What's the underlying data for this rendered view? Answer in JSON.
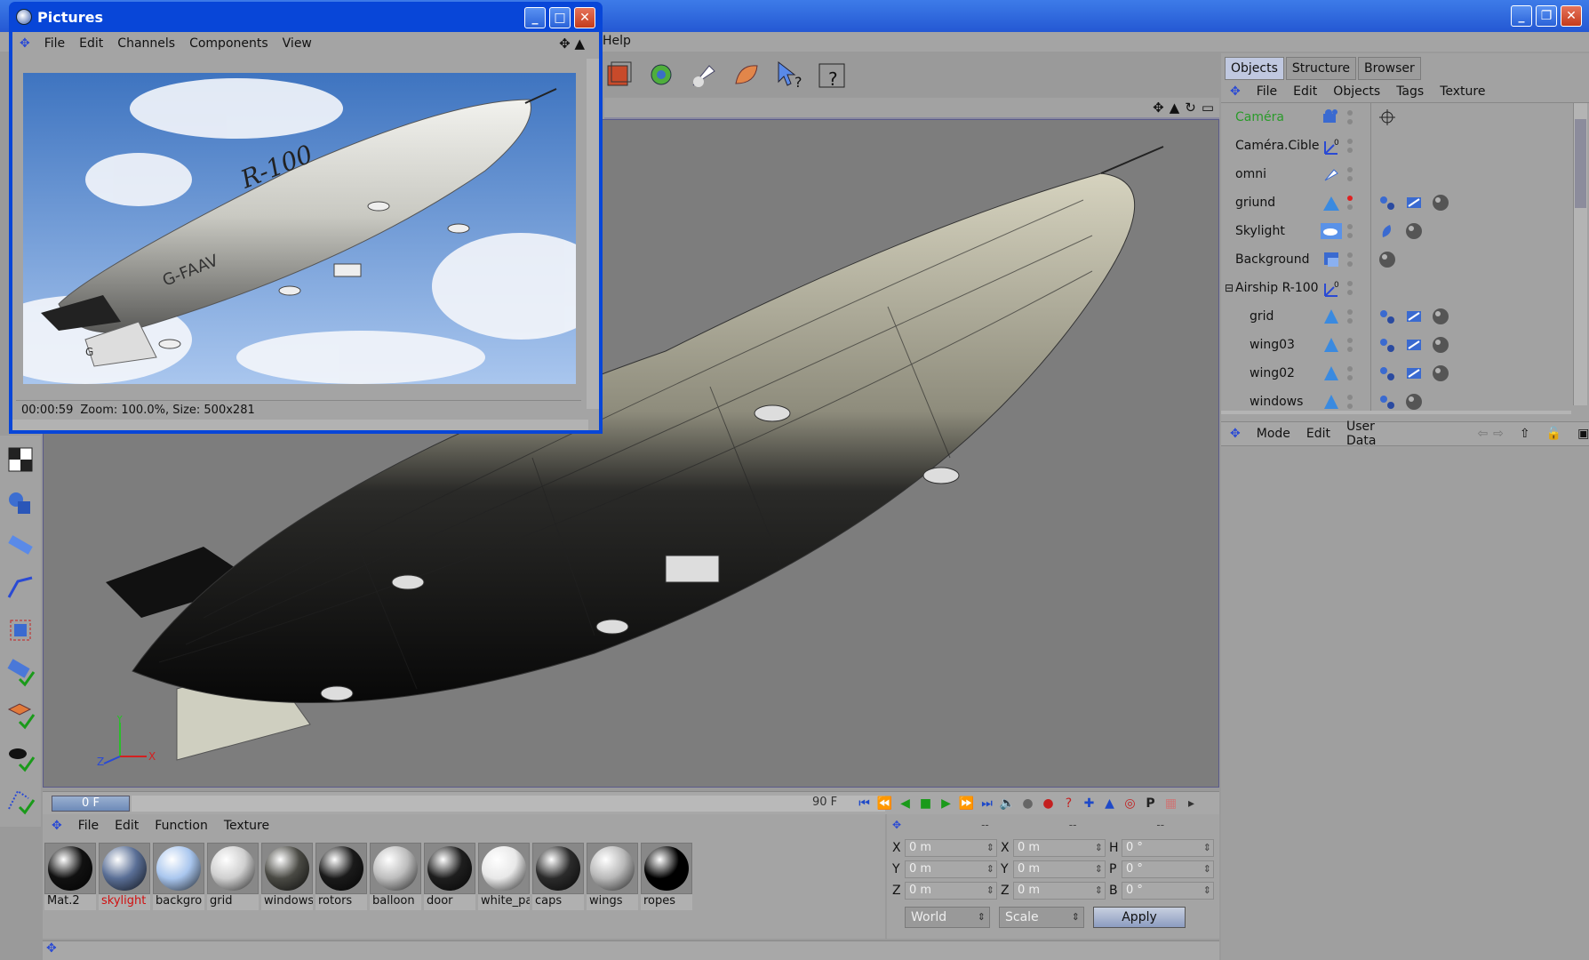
{
  "pictures_window": {
    "title": "Pictures",
    "menu": [
      "File",
      "Edit",
      "Channels",
      "Components",
      "View"
    ],
    "status_time": "00:00:59",
    "status_info": "Zoom: 100.0%, Size: 500x281",
    "render_labels": {
      "hull_text": "R-100",
      "reg_text": "G-FAAV",
      "tail_text": "G"
    }
  },
  "app_menu": {
    "help_label": "Help"
  },
  "viewport": {
    "axis_labels": {
      "x": "X",
      "y": "Y",
      "z": "Z"
    }
  },
  "timeline": {
    "current_frame": "0 F",
    "end_frame": "90 F"
  },
  "material_manager": {
    "menu": [
      "File",
      "Edit",
      "Function",
      "Texture"
    ],
    "materials": [
      {
        "label": "Mat.2",
        "color": "#111111",
        "highlight": false
      },
      {
        "label": "skylight",
        "color": "#5a6f96",
        "highlight": true
      },
      {
        "label": "backgro",
        "color": "#a9c6ee",
        "highlight": false
      },
      {
        "label": "grid",
        "color": "#cfcfcf",
        "highlight": false
      },
      {
        "label": "windows",
        "color": "#4a4a44",
        "highlight": false
      },
      {
        "label": "rotors",
        "color": "#1a1a1a",
        "highlight": false
      },
      {
        "label": "balloon",
        "color": "#bdbdbd",
        "highlight": false
      },
      {
        "label": "door",
        "color": "#1e1e1e",
        "highlight": false
      },
      {
        "label": "white_pa",
        "color": "#e8e8e8",
        "highlight": false
      },
      {
        "label": "caps",
        "color": "#2b2b2b",
        "highlight": false
      },
      {
        "label": "wings",
        "color": "#b8b8b8",
        "highlight": false
      },
      {
        "label": "ropes",
        "color": "#000000",
        "highlight": false
      }
    ]
  },
  "coordinates": {
    "headers": [
      "--",
      "--",
      "--"
    ],
    "rows": [
      {
        "l1": "X",
        "v1": "0 m",
        "l2": "X",
        "v2": "0 m",
        "l3": "H",
        "v3": "0 °"
      },
      {
        "l1": "Y",
        "v1": "0 m",
        "l2": "Y",
        "v2": "0 m",
        "l3": "P",
        "v3": "0 °"
      },
      {
        "l1": "Z",
        "v1": "0 m",
        "l2": "Z",
        "v2": "0 m",
        "l3": "B",
        "v3": "0 °"
      }
    ],
    "mode_world": "World",
    "mode_scale": "Scale",
    "apply_label": "Apply"
  },
  "object_manager": {
    "tabs": [
      "Objects",
      "Structure",
      "Browser"
    ],
    "menu": [
      "File",
      "Edit",
      "Objects",
      "Tags",
      "Texture"
    ],
    "objects": [
      {
        "name": "Caméra",
        "indent": 0,
        "green": true,
        "icon": "camera-icon",
        "dot": "grey",
        "tags": [
          "target-tag-icon"
        ]
      },
      {
        "name": "Caméra.Cible",
        "indent": 0,
        "green": false,
        "icon": "null-object-icon",
        "dot": "grey",
        "tags": []
      },
      {
        "name": "omni",
        "indent": 0,
        "green": false,
        "icon": "light-icon",
        "dot": "grey",
        "tags": []
      },
      {
        "name": "griund",
        "indent": 0,
        "green": false,
        "icon": "floor-icon",
        "dot": "red",
        "tags": [
          "phong-tag-icon",
          "compositing-tag-icon",
          "material-tag-icon"
        ]
      },
      {
        "name": "Skylight",
        "indent": 0,
        "green": false,
        "icon": "sky-icon",
        "dot": "grey",
        "tags": [
          "texture-tag-icon",
          "material-tag-icon"
        ]
      },
      {
        "name": "Background",
        "indent": 0,
        "green": false,
        "icon": "background-icon",
        "dot": "grey",
        "tags": [
          "material-tag-icon"
        ]
      },
      {
        "name": "Airship R-100",
        "indent": 0,
        "green": false,
        "icon": "null-object-icon",
        "dot": "grey",
        "tags": []
      },
      {
        "name": "grid",
        "indent": 1,
        "green": false,
        "icon": "polygon-object-icon",
        "dot": "grey",
        "tags": [
          "phong-tag-icon",
          "compositing-tag-icon",
          "material-tag-icon"
        ]
      },
      {
        "name": "wing03",
        "indent": 1,
        "green": false,
        "icon": "polygon-object-icon",
        "dot": "grey",
        "tags": [
          "phong-tag-icon",
          "compositing-tag-icon",
          "material-tag-icon"
        ]
      },
      {
        "name": "wing02",
        "indent": 1,
        "green": false,
        "icon": "polygon-object-icon",
        "dot": "grey",
        "tags": [
          "phong-tag-icon",
          "compositing-tag-icon",
          "material-tag-icon"
        ]
      },
      {
        "name": "windows",
        "indent": 1,
        "green": false,
        "icon": "polygon-object-icon",
        "dot": "grey",
        "tags": [
          "phong-tag-icon",
          "material-tag-icon"
        ]
      }
    ]
  },
  "attribute_manager": {
    "menu": [
      "Mode",
      "Edit",
      "User Data"
    ]
  },
  "colors": {
    "window_blue": "#0846d8",
    "panel_grey": "#a4a4a4",
    "viewport_grey": "#7d7d7d",
    "active_green": "#2a9b2a",
    "highlight_red": "#d01010"
  }
}
